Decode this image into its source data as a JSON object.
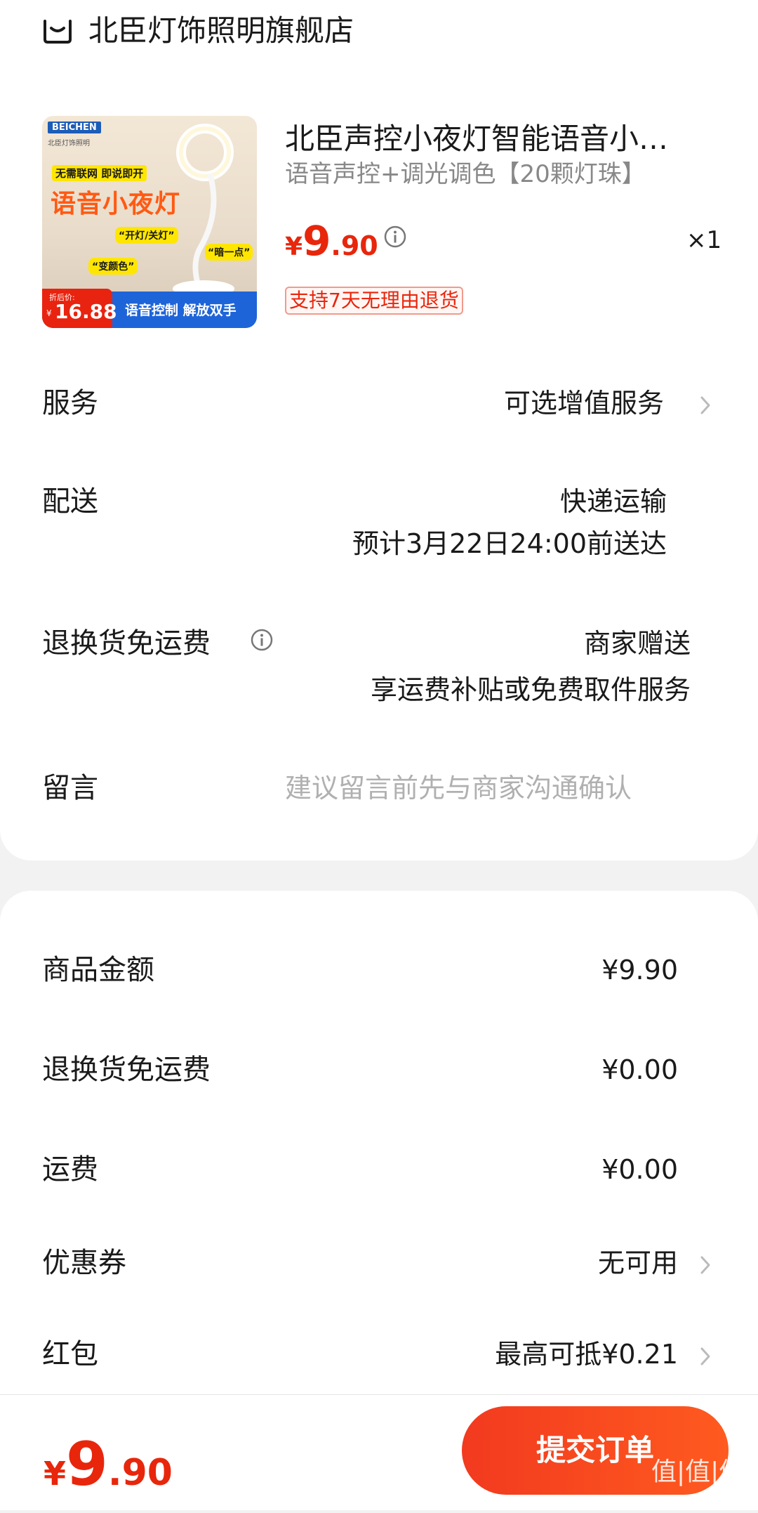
{
  "store": {
    "name": "北臣灯饰照明旗舰店",
    "icon": "store-icon"
  },
  "product": {
    "title": "北臣声控小夜灯智能语音小…",
    "sku": "语音声控+调光调色【20颗灯珠】",
    "price_currency": "¥",
    "price_int": "9",
    "price_dec": ".90",
    "quantity": "×1",
    "return_tag": "支持7天无理由退货",
    "image": {
      "brand": "BEICHEN",
      "brand_sub": "北臣灯饰照明",
      "banner": "无需联网 即说即开",
      "headline": "语音小夜灯",
      "bubble_1": "“开灯/关灯”",
      "bubble_2": "“暗一点”",
      "bubble_3": "“变颜色”",
      "discount_label": "折后价:",
      "discount_currency": "¥",
      "discount_price": "16.88",
      "footer": "语音控制 解放双手"
    }
  },
  "service": {
    "label": "服务",
    "value": "可选增值服务"
  },
  "delivery": {
    "label": "配送",
    "method": "快递运输",
    "eta": "预计3月22日24:00前送达"
  },
  "return_shipping": {
    "label": "退换货免运费",
    "value": "商家赠送",
    "desc": "享运费补贴或免费取件服务"
  },
  "message": {
    "label": "留言",
    "placeholder": "建议留言前先与商家沟通确认"
  },
  "summary": [
    {
      "label": "商品金额",
      "value": "¥9.90"
    },
    {
      "label": "退换货免运费",
      "value": "¥0.00"
    },
    {
      "label": "运费",
      "value": "¥0.00"
    }
  ],
  "coupon": {
    "label": "优惠券",
    "value": "无可用"
  },
  "red_packet": {
    "label": "红包",
    "value": "最高可抵¥0.21"
  },
  "footer": {
    "total_currency": "¥",
    "total_int": "9",
    "total_dec": ".90",
    "submit_label": "提交订单"
  },
  "watermark": "值|值|值",
  "colors": {
    "accent": "#e8260c",
    "muted": "#999999",
    "background": "#f2f2f2"
  }
}
